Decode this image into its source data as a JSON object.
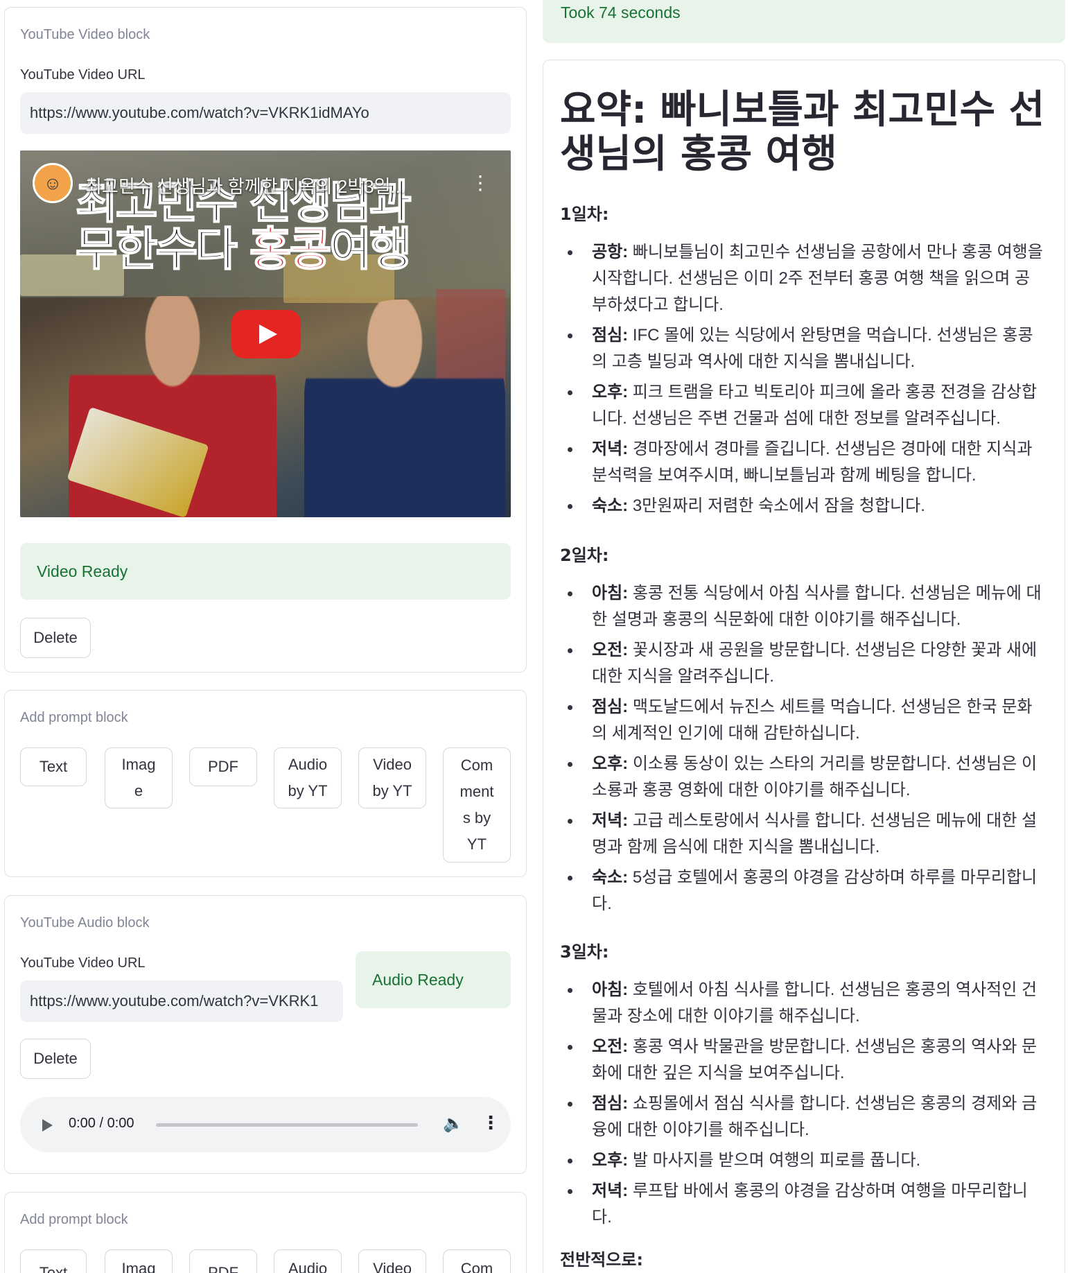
{
  "status": {
    "took": "Took 74 seconds"
  },
  "video_block": {
    "title": "YouTube Video block",
    "url_label": "YouTube Video URL",
    "url_value": "https://www.youtube.com/watch?v=VKRK1idMAYo",
    "video_title": "최고민수 선생님과 함께한 지옥의 2박3일...",
    "thumb_line1": "최고민수 선생님과",
    "thumb_line2_a": "무한수다 ",
    "thumb_line2_b": "홍콩",
    "thumb_line2_c": "여행",
    "status": "Video Ready",
    "delete_label": "Delete"
  },
  "prompt_block_1": {
    "title": "Add prompt block",
    "buttons": [
      "Text",
      "Imag\ne",
      "PDF",
      "Audio\nby YT",
      "Video\nby YT",
      "Com\nment\ns by\nYT"
    ]
  },
  "audio_block": {
    "title": "YouTube Audio block",
    "url_label": "YouTube Video URL",
    "url_value": "https://www.youtube.com/watch?v=VKRK1",
    "status": "Audio Ready",
    "delete_label": "Delete",
    "player_time": "0:00 / 0:00"
  },
  "prompt_block_2": {
    "title": "Add prompt block",
    "buttons": [
      "Text",
      "Imag",
      "PDF",
      "Audio",
      "Video",
      "Com"
    ]
  },
  "summary": {
    "heading": "요약: 빠니보틀과 최고민수 선생님의 홍콩 여행",
    "days": [
      {
        "label": "1일차:",
        "items": [
          {
            "key": "공항:",
            "text": " 빠니보틀님이 최고민수 선생님을 공항에서 만나 홍콩 여행을 시작합니다. 선생님은 이미 2주 전부터 홍콩 여행 책을 읽으며 공부하셨다고 합니다."
          },
          {
            "key": "점심:",
            "text": " IFC 몰에 있는 식당에서 완탕면을 먹습니다. 선생님은 홍콩의 고층 빌딩과 역사에 대한 지식을 뽐내십니다."
          },
          {
            "key": "오후:",
            "text": " 피크 트램을 타고 빅토리아 피크에 올라 홍콩 전경을 감상합니다. 선생님은 주변 건물과 섬에 대한 정보를 알려주십니다."
          },
          {
            "key": "저녁:",
            "text": " 경마장에서 경마를 즐깁니다. 선생님은 경마에 대한 지식과 분석력을 보여주시며, 빠니보틀님과 함께 베팅을 합니다."
          },
          {
            "key": "숙소:",
            "text": " 3만원짜리 저렴한 숙소에서 잠을 청합니다."
          }
        ]
      },
      {
        "label": "2일차:",
        "items": [
          {
            "key": "아침:",
            "text": " 홍콩 전통 식당에서 아침 식사를 합니다. 선생님은 메뉴에 대한 설명과 홍콩의 식문화에 대한 이야기를 해주십니다."
          },
          {
            "key": "오전:",
            "text": " 꽃시장과 새 공원을 방문합니다. 선생님은 다양한 꽃과 새에 대한 지식을 알려주십니다."
          },
          {
            "key": "점심:",
            "text": " 맥도날드에서 뉴진스 세트를 먹습니다. 선생님은 한국 문화의 세계적인 인기에 대해 감탄하십니다."
          },
          {
            "key": "오후:",
            "text": " 이소룡 동상이 있는 스타의 거리를 방문합니다. 선생님은 이소룡과 홍콩 영화에 대한 이야기를 해주십니다."
          },
          {
            "key": "저녁:",
            "text": " 고급 레스토랑에서 식사를 합니다. 선생님은 메뉴에 대한 설명과 함께 음식에 대한 지식을 뽐내십니다."
          },
          {
            "key": "숙소:",
            "text": " 5성급 호텔에서 홍콩의 야경을 감상하며 하루를 마무리합니다."
          }
        ]
      },
      {
        "label": "3일차:",
        "items": [
          {
            "key": "아침:",
            "text": " 호텔에서 아침 식사를 합니다. 선생님은 홍콩의 역사적인 건물과 장소에 대한 이야기를 해주십니다."
          },
          {
            "key": "오전:",
            "text": " 홍콩 역사 박물관을 방문합니다. 선생님은 홍콩의 역사와 문화에 대한 깊은 지식을 보여주십니다."
          },
          {
            "key": "점심:",
            "text": " 쇼핑몰에서 점심 식사를 합니다. 선생님은 홍콩의 경제와 금융에 대한 이야기를 해주십니다."
          },
          {
            "key": "오후:",
            "text": " 발 마사지를 받으며 여행의 피로를 풉니다."
          },
          {
            "key": "저녁:",
            "text": " 루프탑 바에서 홍콩의 야경을 감상하며 여행을 마무리합니다."
          }
        ]
      }
    ],
    "overall_label": "전반적으로:"
  }
}
